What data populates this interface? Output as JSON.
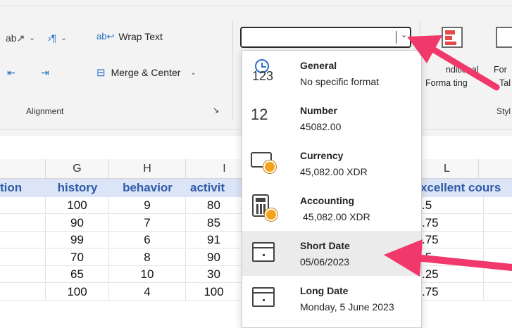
{
  "ribbon": {
    "orientation_icon": "ab↗",
    "indent_icon": "›¶",
    "wrap_text_label": "Wrap Text",
    "decrease_indent_icon": "⇤",
    "increase_indent_icon": "⇥",
    "merge_center_label": "Merge & Center",
    "alignment_group_label": "Alignment",
    "number_format_value": "",
    "conditional_formatting_label_line1": "nditional",
    "conditional_formatting_label_line2": "Forma ting",
    "format_as_table_label_line1": "For",
    "format_as_table_label_line2": "Tal",
    "styles_group_label": "Styl"
  },
  "number_format_menu": {
    "items": [
      {
        "name": "General",
        "sample": "No specific format",
        "icon": "clock-123-icon",
        "icon_text": "123"
      },
      {
        "name": "Number",
        "sample": "45082.00",
        "icon": "number-12-icon",
        "icon_text": "12"
      },
      {
        "name": "Currency",
        "sample": "45,082.00 XDR",
        "icon": "currency-icon"
      },
      {
        "name": "Accounting",
        "sample": "45,082.00 XDR",
        "icon": "accounting-calculator-icon"
      },
      {
        "name": "Short Date",
        "sample": "05/06/2023",
        "icon": "calendar-icon"
      },
      {
        "name": "Long Date",
        "sample": "Monday, 5 June 2023",
        "icon": "calendar-icon"
      }
    ],
    "hovered_index": 4
  },
  "sheet": {
    "column_headers": [
      "G",
      "H",
      "I",
      "L"
    ],
    "title_cells": [
      "tion",
      "history",
      "behavior",
      "activit",
      "xcellent cours"
    ],
    "rows": [
      {
        "g": "100",
        "h": "9",
        "i": "80",
        "l": ".5"
      },
      {
        "g": "90",
        "h": "7",
        "i": "85",
        "l": ".75"
      },
      {
        "g": "99",
        "h": "6",
        "i": "91",
        "l": ".75"
      },
      {
        "g": "70",
        "h": "8",
        "i": "90",
        "l": ".5"
      },
      {
        "g": "65",
        "h": "10",
        "i": "30",
        "l": ".25"
      },
      {
        "g": "100",
        "h": "4",
        "i": "100",
        "l": ".75"
      }
    ]
  },
  "colors": {
    "accent_arrow": "#f0386b",
    "title_text": "#2e5aa8",
    "title_fill": "#dbe5f7"
  }
}
